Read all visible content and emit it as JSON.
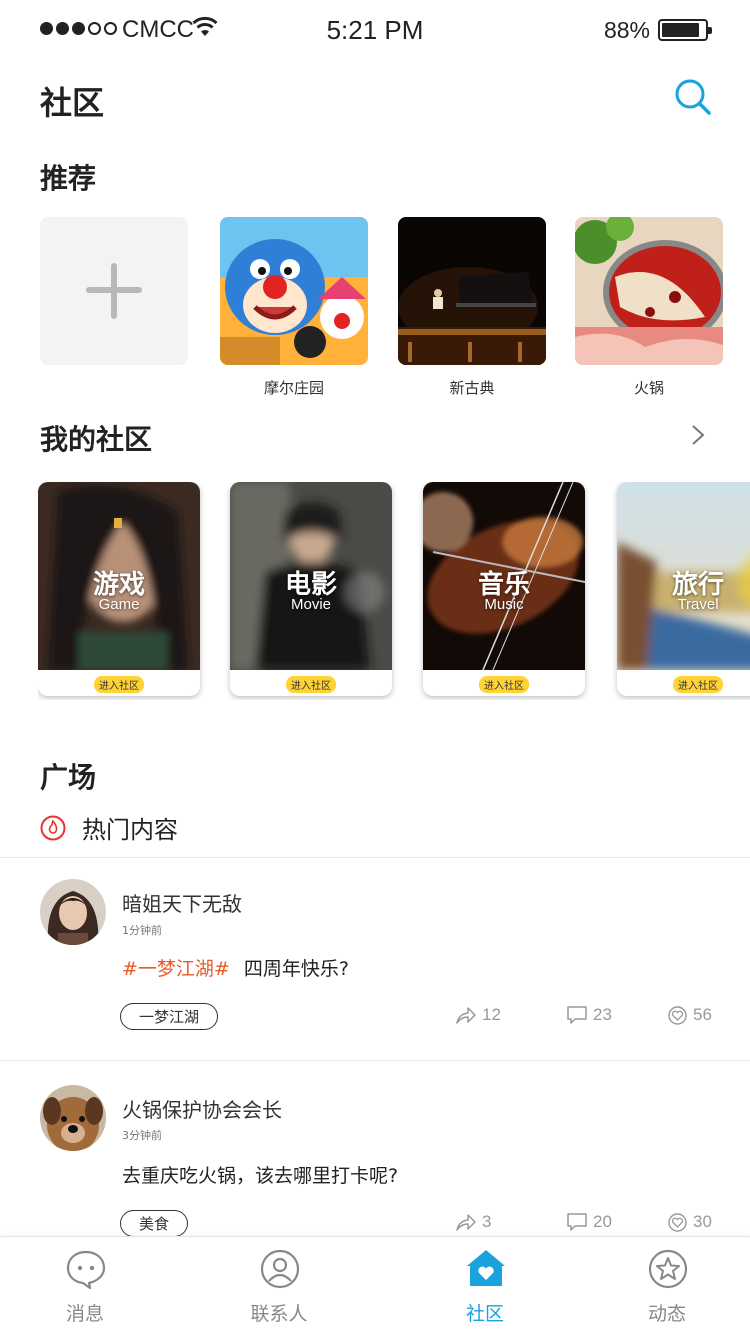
{
  "status_bar": {
    "carrier": "CMCC",
    "time": "5:21 PM",
    "battery": "88%"
  },
  "header": {
    "title": "社区"
  },
  "recommend": {
    "title": "推荐",
    "items": [
      {
        "label": ""
      },
      {
        "label": "摩尔庄园"
      },
      {
        "label": "新古典"
      },
      {
        "label": "火锅"
      }
    ]
  },
  "my_community": {
    "title": "我的社区",
    "cards": [
      {
        "name": "游戏",
        "en": "Game",
        "enter": "进入社区"
      },
      {
        "name": "电影",
        "en": "Movie",
        "enter": "进入社区"
      },
      {
        "name": "音乐",
        "en": "Music",
        "enter": "进入社区"
      },
      {
        "name": "旅行",
        "en": "Travel",
        "enter": "进入社区"
      }
    ]
  },
  "plaza": {
    "title": "广场",
    "hot_label": "热门内容"
  },
  "posts": [
    {
      "user": "暗姐天下无敌",
      "time": "1分钟前",
      "tag": "#一梦江湖#",
      "text": "四周年快乐?",
      "chip": "一梦江湖",
      "shares": "12",
      "comments": "23",
      "likes": "56"
    },
    {
      "user": "火锅保护协会会长",
      "time": "3分钟前",
      "tag": "",
      "text": "去重庆吃火锅，该去哪里打卡呢?",
      "chip": "美食",
      "shares": "3",
      "comments": "20",
      "likes": "30"
    }
  ],
  "tabbar": {
    "tabs": [
      {
        "label": "消息"
      },
      {
        "label": "联系人"
      },
      {
        "label": "社区"
      },
      {
        "label": "动态"
      }
    ]
  },
  "colors": {
    "accent": "#19a2dc",
    "tag": "#e85a28",
    "badge": "#ffd335",
    "hot": "#e8322e"
  }
}
